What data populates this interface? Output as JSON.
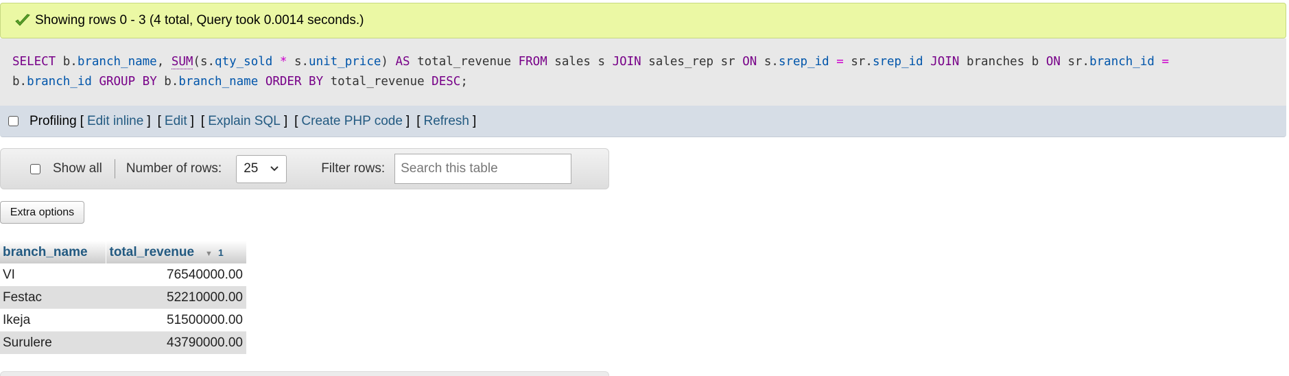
{
  "success": {
    "message": "Showing rows 0 - 3 (4 total, Query took 0.0014 seconds.)",
    "icon": "check-icon",
    "color": "#ebf8a4"
  },
  "sql": {
    "t0": "SELECT",
    "t1": " b.",
    "t2": "branch_name",
    "t3": ", ",
    "t4": "SUM",
    "t5": "(s.",
    "t6": "qty_sold",
    "t7": " ",
    "t8": "*",
    "t9": " s.",
    "t10": "unit_price",
    "t11": ") ",
    "t12": "AS",
    "t13": " total_revenue ",
    "t14": "FROM",
    "t15": " sales s ",
    "t16": "JOIN",
    "t17": " sales_rep sr ",
    "t18": "ON",
    "t19": " s.",
    "t20": "srep_id",
    "t21": " ",
    "t22": "=",
    "t23": " sr.",
    "t24": "srep_id",
    "t25": " ",
    "t26": "JOIN",
    "t27": " branches b ",
    "t28": "ON",
    "t29": " sr.",
    "t30": "branch_id",
    "t31": " ",
    "t32": "=",
    "t33": "\nb.",
    "t34": "branch_id",
    "t35": " ",
    "t36": "GROUP BY",
    "t37": " b.",
    "t38": "branch_name",
    "t39": " ",
    "t40": "ORDER BY",
    "t41": " total_revenue ",
    "t42": "DESC",
    "t43": ";"
  },
  "profiling": {
    "label": "Profiling",
    "open_bracket": "[",
    "close_bracket": "]",
    "links": {
      "edit_inline": "Edit inline",
      "edit": "Edit",
      "explain": "Explain SQL",
      "php": "Create PHP code",
      "refresh": "Refresh"
    }
  },
  "nav": {
    "show_all": "Show all",
    "rows_label": "Number of rows:",
    "rows_value": "25",
    "filter_label": "Filter rows:",
    "filter_placeholder": "Search this table"
  },
  "extra_options": "Extra options",
  "table": {
    "columns": [
      "branch_name",
      "total_revenue"
    ],
    "sort_number": "1",
    "rows": [
      [
        "VI",
        "76540000.00"
      ],
      [
        "Festac",
        "52210000.00"
      ],
      [
        "Ikeja",
        "51500000.00"
      ],
      [
        "Surulere",
        "43790000.00"
      ]
    ]
  },
  "colors": {
    "link": "#235a81",
    "keyword": "#770088",
    "identifier": "#0055aa",
    "operator": "#cc00cc"
  }
}
